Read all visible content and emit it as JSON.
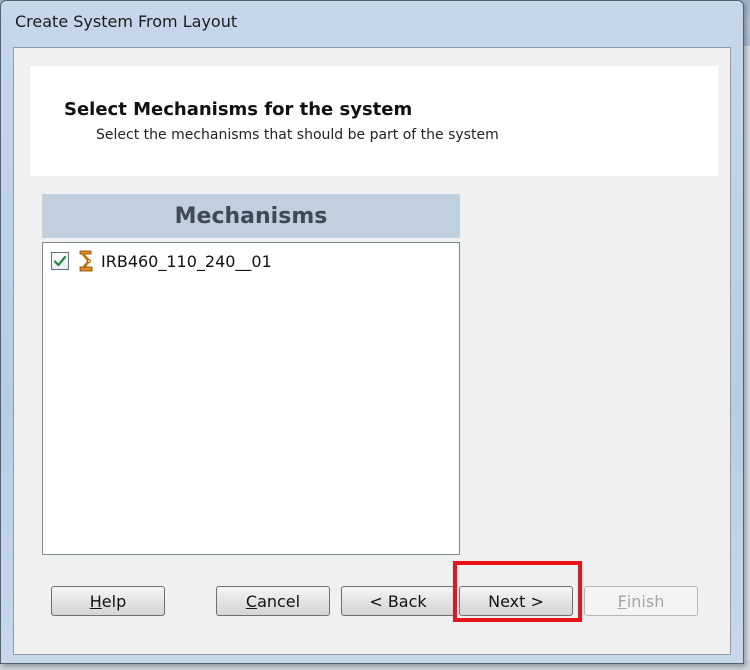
{
  "window": {
    "title": "Create System From Layout"
  },
  "header": {
    "title": "Select Mechanisms for the system",
    "subtitle": "Select the mechanisms that should be part of the system"
  },
  "mechanisms": {
    "heading": "Mechanisms",
    "items": [
      {
        "label": "IRB460_110_240__01",
        "checked": true,
        "icon": "robot-icon"
      }
    ]
  },
  "buttons": {
    "help": {
      "first": "H",
      "rest": "elp"
    },
    "cancel": {
      "first": "C",
      "rest": "ancel"
    },
    "back": {
      "label": "< Back"
    },
    "next": {
      "label": "Next >"
    },
    "finish": {
      "first": "F",
      "rest": "inish",
      "enabled": false
    }
  },
  "annotation": {
    "highlight_color": "#e8141c",
    "highlighted": "next-button"
  },
  "colors": {
    "accent_check": "#1e8e3e",
    "robot_orange": "#e58b1a"
  }
}
